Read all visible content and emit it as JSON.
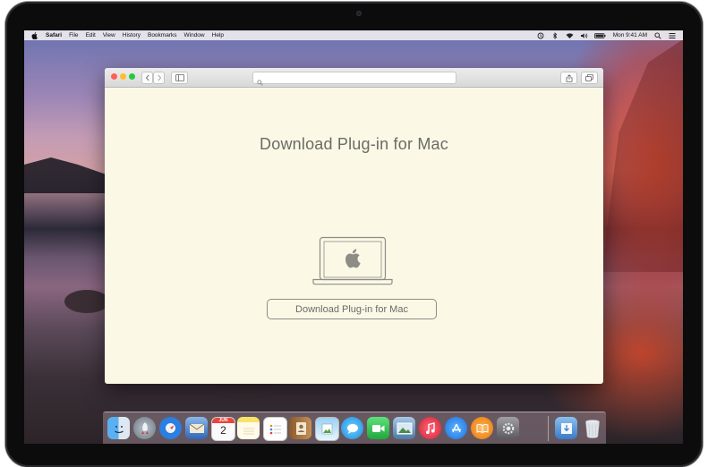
{
  "menubar": {
    "app_name": "Safari",
    "menus": [
      "File",
      "Edit",
      "View",
      "History",
      "Bookmarks",
      "Window",
      "Help"
    ],
    "clock": "Mon 9:41 AM"
  },
  "browser": {
    "url_placeholder": ""
  },
  "page": {
    "title": "Download Plug-in for Mac",
    "button_label": "Download Plug-in for Mac"
  },
  "dock": {
    "calendar_month": "JUN",
    "calendar_day": "2",
    "icons": [
      {
        "name": "finder-icon",
        "color": "#2a8fe8"
      },
      {
        "name": "launchpad-icon",
        "color": "#7d8a99"
      },
      {
        "name": "safari-icon",
        "color": "#2a7fe0"
      },
      {
        "name": "mail-icon",
        "color": "#3c78c8"
      },
      {
        "name": "calendar-icon",
        "color": "#ffffff"
      },
      {
        "name": "notes-icon",
        "color": "#f7e36a"
      },
      {
        "name": "reminders-icon",
        "color": "#f4f4f4"
      },
      {
        "name": "contacts-icon",
        "color": "#b07a44"
      },
      {
        "name": "preview-icon",
        "color": "#5fa8e0"
      },
      {
        "name": "messages-icon",
        "color": "#3cb4f0"
      },
      {
        "name": "facetime-icon",
        "color": "#2ec24e"
      },
      {
        "name": "photos-icon",
        "color": "#6aa0d0"
      },
      {
        "name": "itunes-icon",
        "color": "#e8384a"
      },
      {
        "name": "app-store-icon",
        "color": "#2a8ef0"
      },
      {
        "name": "ibooks-icon",
        "color": "#f08a18"
      },
      {
        "name": "system-preferences-icon",
        "color": "#8a8a8e"
      },
      {
        "name": "downloads-folder-icon",
        "color": "#5c9ad8"
      },
      {
        "name": "trash-icon",
        "color": "#d8dde2"
      }
    ]
  }
}
